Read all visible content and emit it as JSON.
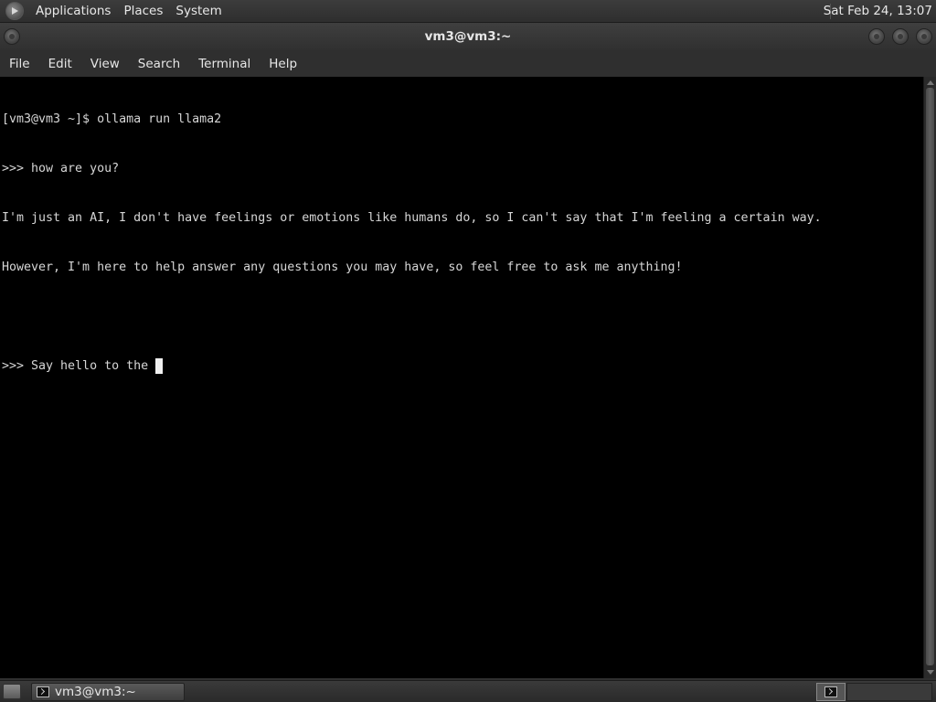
{
  "top_panel": {
    "menus": [
      "Applications",
      "Places",
      "System"
    ],
    "clock": "Sat Feb 24, 13:07"
  },
  "window": {
    "title": "vm3@vm3:~",
    "menus": [
      "File",
      "Edit",
      "View",
      "Search",
      "Terminal",
      "Help"
    ]
  },
  "terminal": {
    "lines": [
      "[vm3@vm3 ~]$ ollama run llama2",
      ">>> how are you?",
      "I'm just an AI, I don't have feelings or emotions like humans do, so I can't say that I'm feeling a certain way.",
      "However, I'm here to help answer any questions you may have, so feel free to ask me anything!",
      ""
    ],
    "current_input": ">>> Say hello to the "
  },
  "taskbar": {
    "task_label": "vm3@vm3:~"
  }
}
